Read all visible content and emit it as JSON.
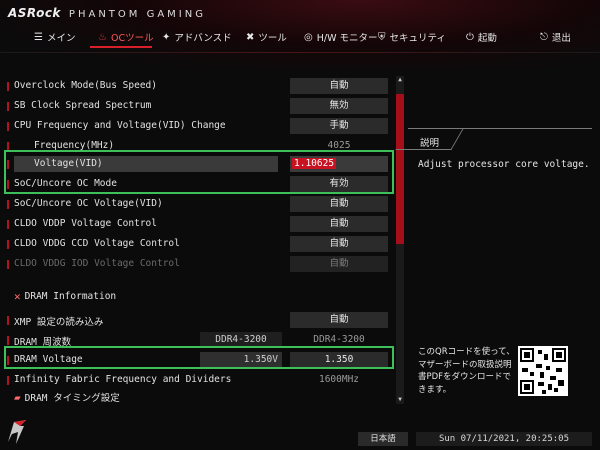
{
  "brand": {
    "name": "ASRock",
    "sub": "PHANTOM GAMING"
  },
  "nav": {
    "tabs": [
      {
        "icon": "☰",
        "icon_name": "menu-icon",
        "label": "メイン"
      },
      {
        "icon": "♨",
        "icon_name": "flame-icon",
        "label": "OCツール",
        "active": true
      },
      {
        "icon": "✦",
        "icon_name": "star-icon",
        "label": "アドバンスド"
      },
      {
        "icon": "✖",
        "icon_name": "tools-icon",
        "label": "ツール"
      },
      {
        "icon": "◎",
        "icon_name": "monitor-icon",
        "label": "H/W モニター"
      },
      {
        "icon": "⛨",
        "icon_name": "shield-icon",
        "label": "セキュリティ"
      },
      {
        "icon": "⏻",
        "icon_name": "power-icon",
        "label": "起動"
      },
      {
        "icon": "⎋",
        "icon_name": "exit-icon",
        "label": "退出"
      }
    ]
  },
  "settings": [
    {
      "label": "Overclock Mode(Bus Speed)",
      "value": "自動"
    },
    {
      "label": "SB Clock Spread Spectrum",
      "value": "無効"
    },
    {
      "label": "CPU Frequency and Voltage(VID) Change",
      "value": "手動"
    },
    {
      "label": "Frequency(MHz)",
      "value": "4025"
    },
    {
      "label": "Voltage(VID)",
      "value": "1.10625"
    },
    {
      "label": "SoC/Uncore OC Mode",
      "value": "有効"
    },
    {
      "label": "SoC/Uncore OC Voltage(VID)",
      "value": "自動"
    },
    {
      "label": "CLDO VDDP Voltage Control",
      "value": "自動"
    },
    {
      "label": "CLDO VDDG CCD Voltage Control",
      "value": "自動"
    },
    {
      "label": "CLDO VDDG IOD Voltage Control",
      "value": "自動"
    }
  ],
  "dram": {
    "section_label": "DRAM Information",
    "rows": [
      {
        "label": "XMP 設定の読み込み",
        "value": "自動"
      },
      {
        "label": "DRAM 周波数",
        "current": "DDR4-3200",
        "value": "DDR4-3200"
      },
      {
        "label": "DRAM Voltage",
        "current": "1.350V",
        "value": "1.350"
      },
      {
        "label": "Infinity Fabric Frequency and Dividers",
        "value": "1600MHz"
      }
    ],
    "timing_label": "DRAM タイミング設定"
  },
  "help": {
    "title": "説明",
    "text": "Adjust processor core voltage."
  },
  "qr": {
    "text": "このQRコードを使って、マザーボードの取扱説明書PDFをダウンロードできます。"
  },
  "footer": {
    "language": "日本語",
    "datetime": "Sun 07/11/2021, 20:25:05"
  },
  "colors": {
    "accent": "#d8202a",
    "highlight_box": "#3dbf5a"
  }
}
